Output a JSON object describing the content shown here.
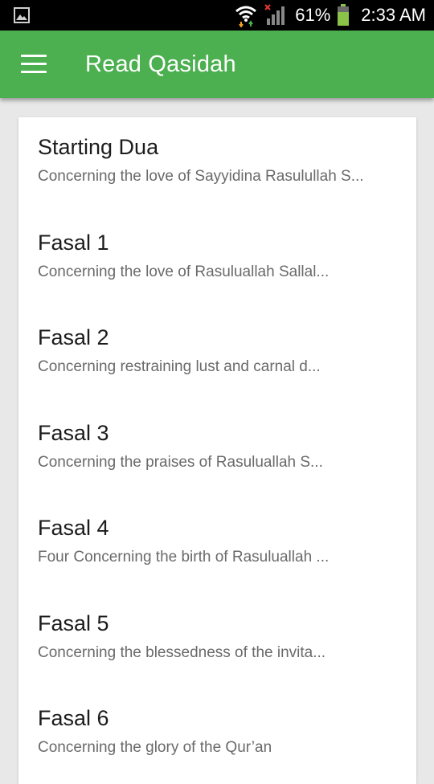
{
  "status_bar": {
    "battery": "61%",
    "time": "2:33 AM",
    "icons": [
      "image-icon",
      "wifi-icon",
      "signal-icon",
      "battery-icon"
    ]
  },
  "app_bar": {
    "title": "Read Qasidah",
    "menu_icon": "hamburger-menu-icon",
    "color": "#4caf50"
  },
  "list": [
    {
      "title": "Starting Dua",
      "subtitle": "Concerning the love of Sayyidina Rasulullah S..."
    },
    {
      "title": "Fasal 1",
      "subtitle": "Concerning the love of Rasuluallah Sallal..."
    },
    {
      "title": "Fasal 2",
      "subtitle": "Concerning restraining lust and carnal d..."
    },
    {
      "title": "Fasal 3",
      "subtitle": "Concerning the praises of Rasuluallah S..."
    },
    {
      "title": "Fasal 4",
      "subtitle": "Four Concerning the birth of Rasuluallah ..."
    },
    {
      "title": "Fasal 5",
      "subtitle": "Concerning the blessedness of the invita..."
    },
    {
      "title": "Fasal 6",
      "subtitle": "Concerning the glory of the Qur’an"
    }
  ]
}
